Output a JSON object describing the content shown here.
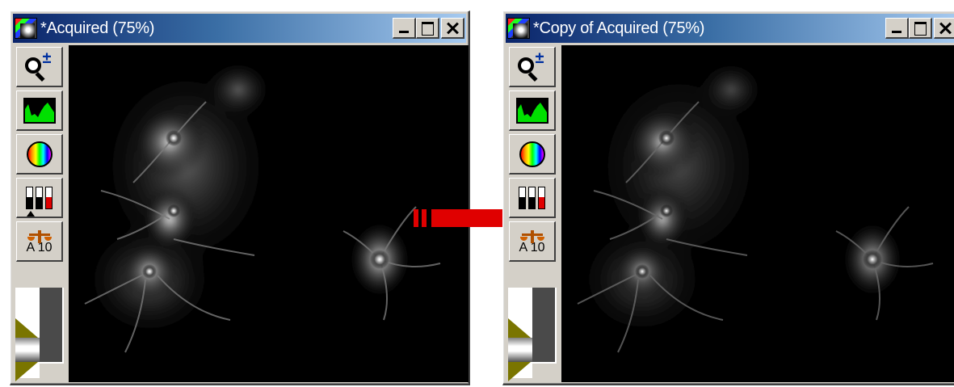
{
  "windows": [
    {
      "title": "*Acquired (75%)",
      "toolbar": {
        "scale_label": "A 10"
      }
    },
    {
      "title": "*Copy of Acquired (75%)",
      "toolbar": {
        "scale_label": "A 10"
      }
    }
  ],
  "icons": {
    "app": "image-app-icon",
    "zoom": "zoom-icon",
    "histogram": "histogram-icon",
    "color": "color-wheel-icon",
    "lut": "lut-icon",
    "scale": "scale-balance-icon",
    "arrow": "right-arrow-icon"
  },
  "colors": {
    "title_gradient_start": "#0a246a",
    "title_gradient_end": "#a6caf0",
    "arrow": "#e00000",
    "window_bg": "#d4d0c8"
  }
}
